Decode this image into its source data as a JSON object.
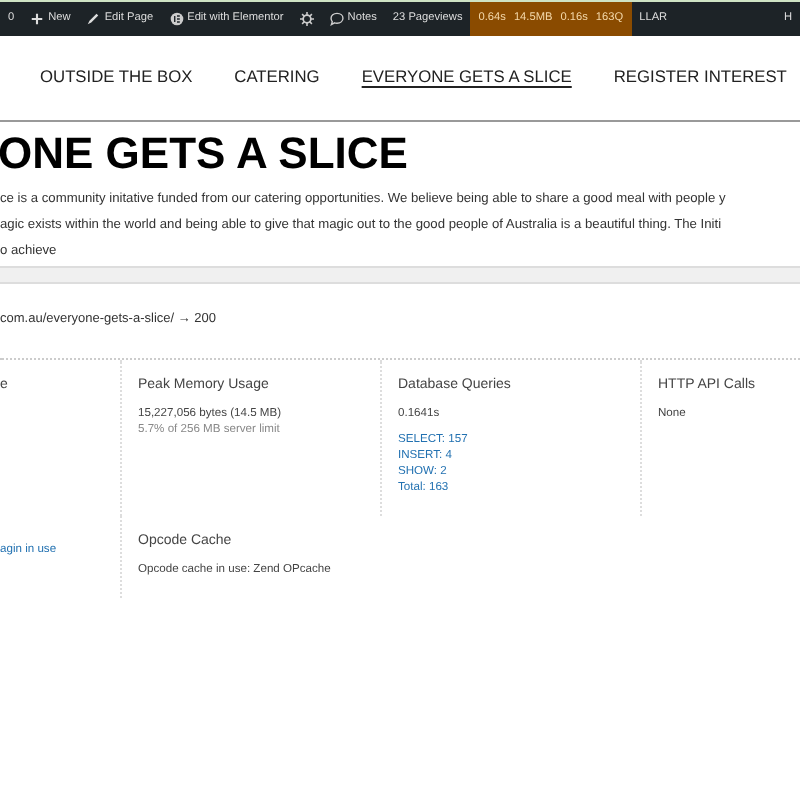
{
  "admin_bar": {
    "items": [
      {
        "kind": "plain",
        "label": "0"
      },
      {
        "kind": "plus",
        "label": "New"
      },
      {
        "kind": "pencil",
        "label": "Edit Page"
      },
      {
        "kind": "elementor",
        "label": "Edit with Elementor"
      },
      {
        "kind": "gear"
      },
      {
        "kind": "speech",
        "label": "Notes"
      },
      {
        "kind": "plain",
        "label": "23 Pageviews"
      }
    ],
    "perf": [
      "0.64s",
      "14.5MB",
      "0.16s",
      "163Q"
    ],
    "after": [
      "LLAR"
    ],
    "right": "H"
  },
  "nav": [
    {
      "label": "OUTSIDE THE BOX",
      "selected": false
    },
    {
      "label": "CATERING",
      "selected": false
    },
    {
      "label": "EVERYONE GETS A SLICE",
      "selected": true
    },
    {
      "label": "REGISTER INTEREST",
      "selected": false
    }
  ],
  "page_title": "ONE GETS A SLICE",
  "paragraph_lines": [
    "ce is a community initative funded from our catering opportunities. We believe being able to share a good meal with people y",
    "agic exists within the world and being able to give that magic out to the good people of Australia is a beautiful thing. The Initi",
    "o achieve"
  ],
  "query_monitor": {
    "url": "com.au/everyone-gets-a-slice/ → 200",
    "rows": [
      [
        {
          "title": "e"
        },
        {
          "title": "Peak Memory Usage",
          "items": [
            {
              "kind": "text",
              "text": "15,227,056 bytes (14.5 MB)"
            },
            {
              "kind": "muted",
              "text": "5.7% of 256 MB server limit"
            }
          ]
        },
        {
          "title": "Database Queries",
          "items": [
            {
              "kind": "text",
              "text": "0.1641s"
            },
            {
              "kind": "link",
              "text": "SELECT: 157"
            },
            {
              "kind": "link",
              "text": "INSERT: 4"
            },
            {
              "kind": "link",
              "text": "SHOW: 2"
            },
            {
              "kind": "link",
              "text": "Total: 163"
            }
          ]
        },
        {
          "title": "HTTP API Calls",
          "items": [
            {
              "kind": "text",
              "text": "None"
            }
          ]
        }
      ],
      [
        {
          "items": [
            {
              "kind": "link",
              "text": "agin in use"
            }
          ]
        },
        {
          "title": "Opcode Cache",
          "items": [
            {
              "kind": "text",
              "text": "Opcode cache in use: Zend OPcache"
            }
          ]
        }
      ]
    ]
  }
}
